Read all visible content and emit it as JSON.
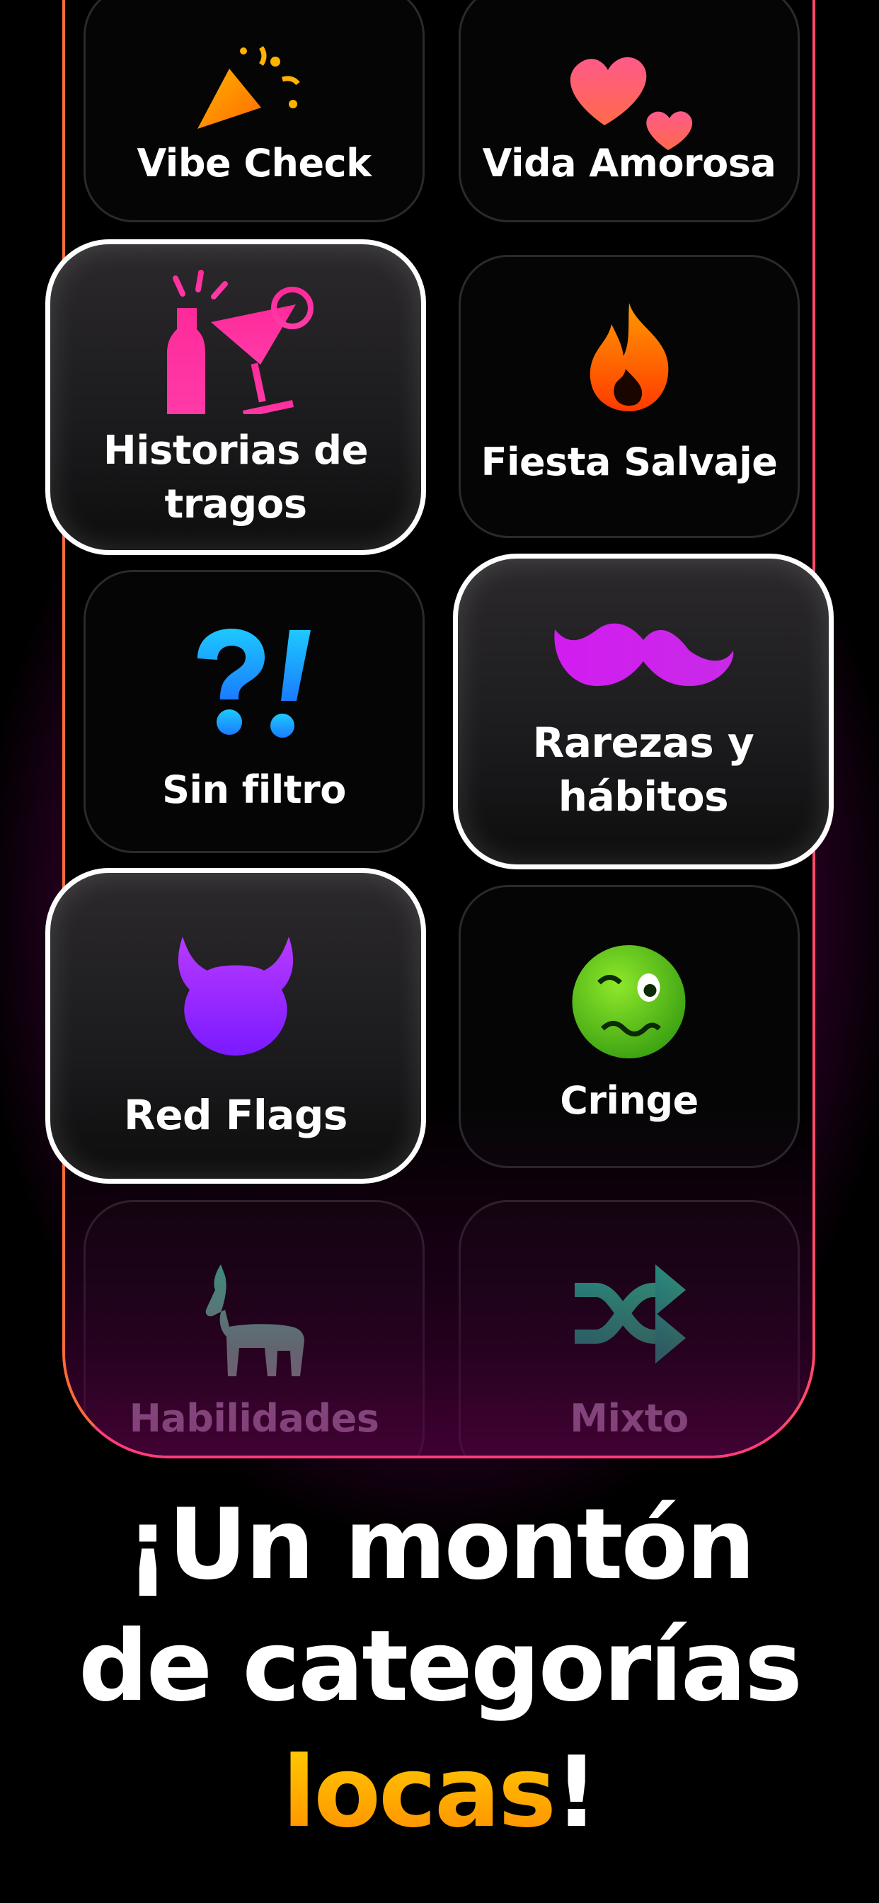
{
  "categories": [
    {
      "id": "vibe",
      "label": "Vibe Check",
      "icon": "party-popper-icon",
      "selected": false
    },
    {
      "id": "love",
      "label": "Vida Amorosa",
      "icon": "two-hearts-icon",
      "selected": false
    },
    {
      "id": "drinks",
      "label": "Historias de tragos",
      "icon": "cocktail-bottle-icon",
      "selected": true
    },
    {
      "id": "party",
      "label": "Fiesta Salvaje",
      "icon": "fire-icon",
      "selected": false
    },
    {
      "id": "nofilter",
      "label": "Sin filtro",
      "icon": "question-exclamation-icon",
      "selected": false
    },
    {
      "id": "quirks",
      "label": "Rarezas y hábitos",
      "icon": "mustache-icon",
      "selected": true
    },
    {
      "id": "redflags",
      "label": "Red Flags",
      "icon": "devil-icon",
      "selected": true
    },
    {
      "id": "cringe",
      "label": "Cringe",
      "icon": "woozy-face-icon",
      "selected": false
    },
    {
      "id": "skills",
      "label": "Habilidades",
      "icon": "goat-icon",
      "selected": false
    },
    {
      "id": "mixed",
      "label": "Mixto",
      "icon": "shuffle-icon",
      "selected": false
    }
  ],
  "headline": {
    "line1": "¡Un montón",
    "line2": "de categorías",
    "accent": "locas",
    "end": "!"
  },
  "colors": {
    "accent": "#ffb000",
    "phone_border": "#ff6a3a",
    "selected_border": "#ffffff"
  }
}
